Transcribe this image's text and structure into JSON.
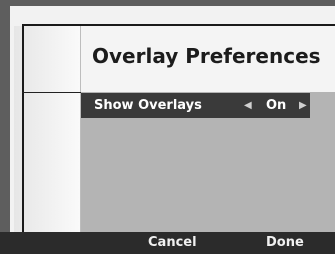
{
  "dialog": {
    "title": "Overlay Preferences"
  },
  "options": [
    {
      "label": "Show Overlays",
      "value": "On",
      "left_icon": "arrow-left-icon",
      "right_icon": "arrow-right-icon"
    }
  ],
  "softkeys": {
    "left_label": "Cancel",
    "right_label": "Done"
  },
  "colors": {
    "background": "#5e5e5e",
    "panel": "#b4b4b4",
    "selected_row": "#3a3a3a",
    "softkey_bar": "#2b2b2b"
  }
}
